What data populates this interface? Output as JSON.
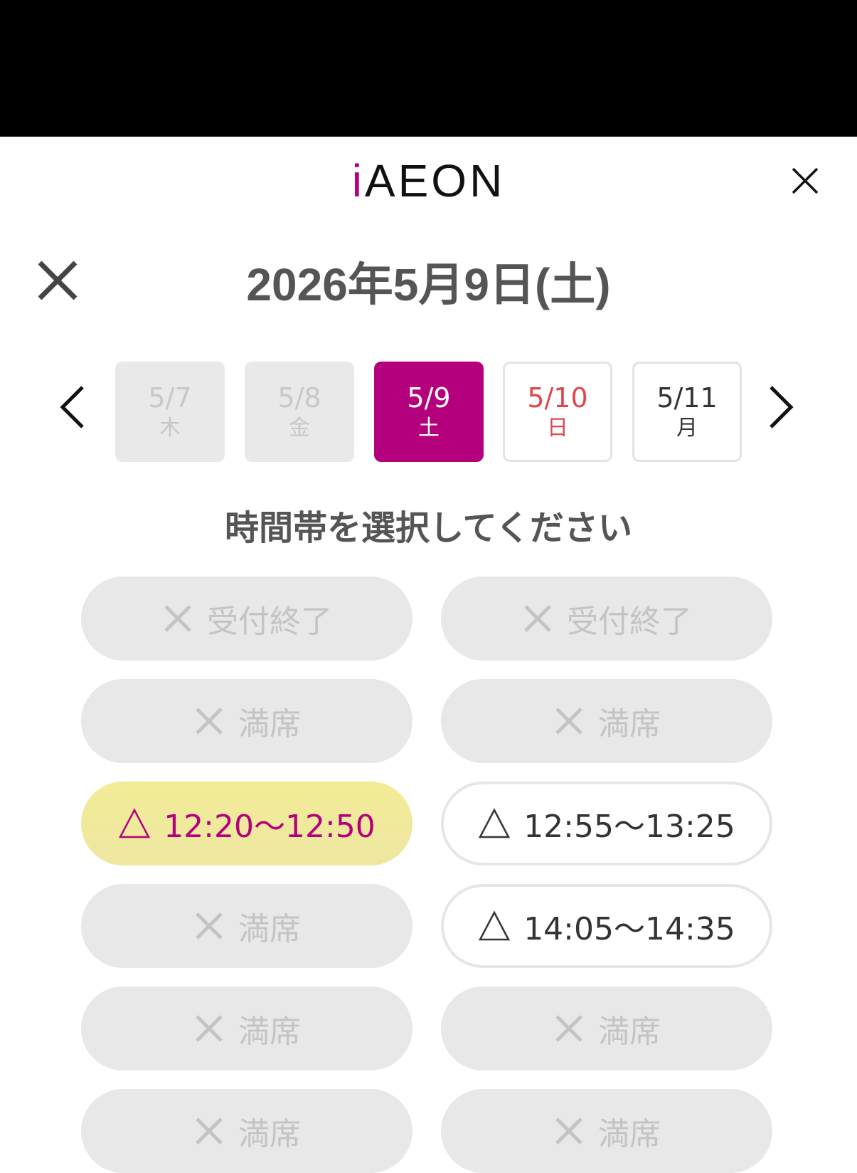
{
  "header": {
    "logo_prefix": "i",
    "logo_text": "AEON"
  },
  "title": "2026年5月9日(土)",
  "days": [
    {
      "date": "5/7",
      "weekday": "木",
      "state": "disabled"
    },
    {
      "date": "5/8",
      "weekday": "金",
      "state": "disabled"
    },
    {
      "date": "5/9",
      "weekday": "土",
      "state": "selected"
    },
    {
      "date": "5/10",
      "weekday": "日",
      "state": "sunday"
    },
    {
      "date": "5/11",
      "weekday": "月",
      "state": "available"
    }
  ],
  "subtitle": "時間帯を選択してください",
  "slots": [
    {
      "label": "受付終了",
      "status": "closed"
    },
    {
      "label": "受付終了",
      "status": "closed"
    },
    {
      "label": "満席",
      "status": "full"
    },
    {
      "label": "満席",
      "status": "full"
    },
    {
      "label": "12:20〜12:50",
      "status": "few-left",
      "highlighted": true
    },
    {
      "label": "12:55〜13:25",
      "status": "few-left"
    },
    {
      "label": "満席",
      "status": "full"
    },
    {
      "label": "14:05〜14:35",
      "status": "few-left"
    },
    {
      "label": "満席",
      "status": "full"
    },
    {
      "label": "満席",
      "status": "full"
    },
    {
      "label": "満席",
      "status": "full"
    },
    {
      "label": "満席",
      "status": "full"
    }
  ],
  "colors": {
    "brand": "#b5007e",
    "sunday": "#e0474c",
    "highlight": "#f0e99a",
    "disabled_bg": "#e8e8e8",
    "disabled_text": "#c4c4c4"
  },
  "icons": {
    "closed": "cross-icon",
    "full": "cross-icon",
    "few-left": "triangle-icon"
  }
}
